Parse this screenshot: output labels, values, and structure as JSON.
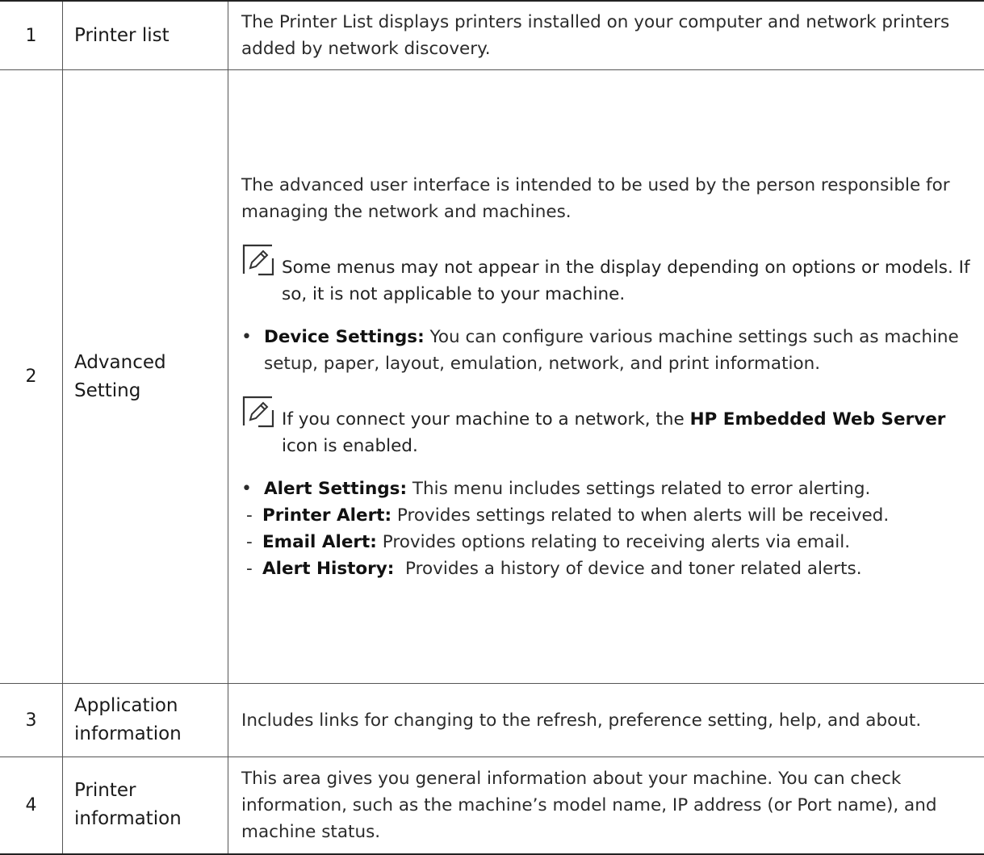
{
  "rows": [
    {
      "num": "1",
      "name": "Printer list",
      "desc": "The Printer List displays printers installed on your computer and network printers added by network discovery."
    },
    {
      "num": "2",
      "name": "Advanced Setting",
      "intro": "The advanced user interface is intended to be used by the person responsible for managing the network and machines.",
      "note1": "Some menus may not appear in the display depending on options or models. If so, it is not applicable to your machine.",
      "device_settings": {
        "bullet": "•",
        "label": "Device Settings:",
        "text": " You can configure various machine settings such as machine setup, paper, layout, emulation, network, and print information."
      },
      "note2": {
        "before": "If you connect your machine to a network, the ",
        "bold": "HP Embedded Web Server",
        "after": " icon is enabled."
      },
      "alert_settings": {
        "bullet": "•",
        "label": "Alert Settings:",
        "text": " This menu includes settings related to error alerting.",
        "items": [
          {
            "dash": "-",
            "label": "Printer Alert:",
            "text": " Provides settings related to when alerts will be received."
          },
          {
            "dash": "-",
            "label": "Email Alert:",
            "text": " Provides options relating to receiving alerts via email."
          },
          {
            "dash": "-",
            "label": "Alert History:",
            "text": "  Provides a history of device and toner related alerts."
          }
        ]
      }
    },
    {
      "num": "3",
      "name": "Application information",
      "desc": "Includes links for changing to the refresh, preference setting, help, and about."
    },
    {
      "num": "4",
      "name": "Printer information",
      "desc": "This area gives you general information about your machine. You can check information, such as the machine’s model name, IP address (or Port name), and machine status."
    }
  ],
  "icons": {
    "note": "note-pencil-icon"
  }
}
